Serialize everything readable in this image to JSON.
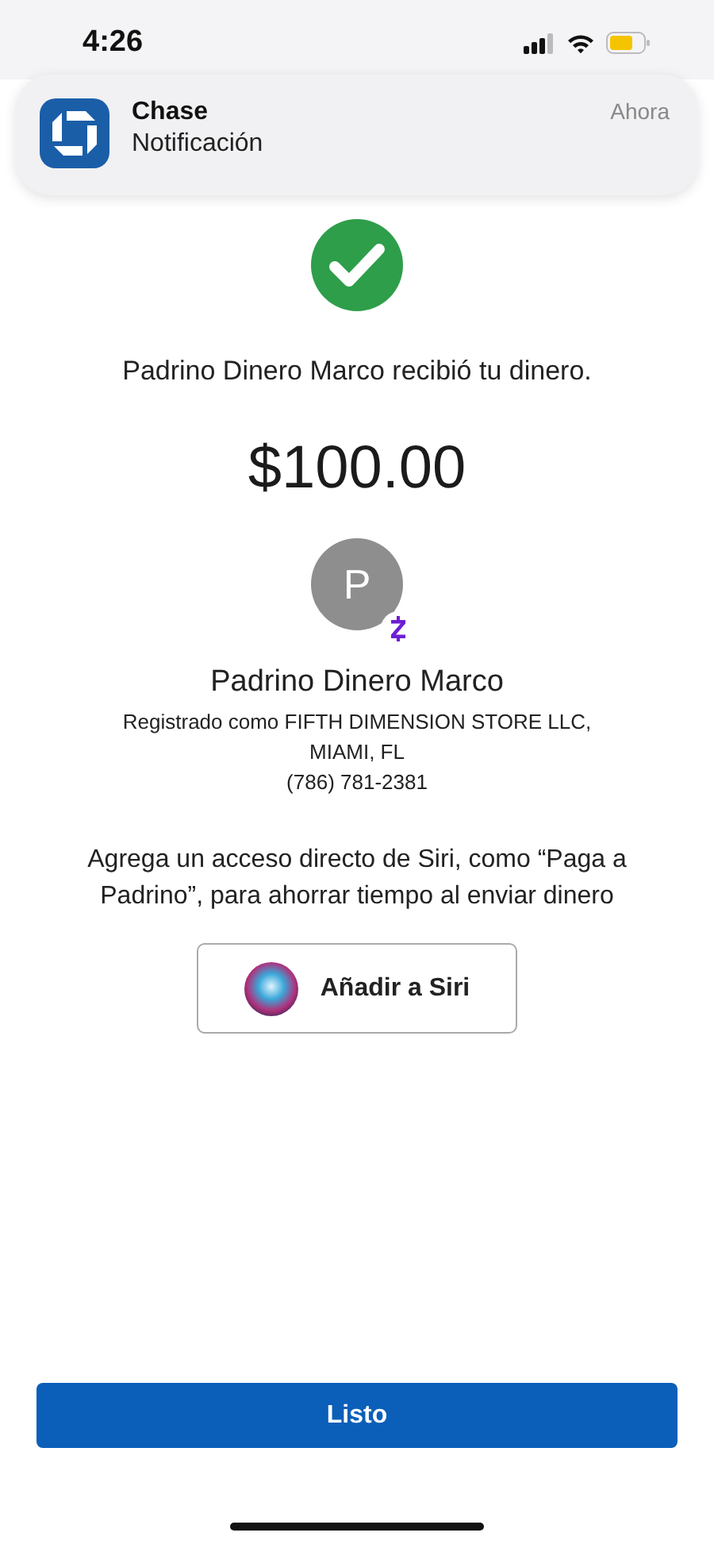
{
  "status_bar": {
    "time": "4:26"
  },
  "notification": {
    "app": "Chase",
    "message": "Notificación",
    "time": "Ahora"
  },
  "confirmation": {
    "message": "Padrino Dinero Marco recibió tu dinero.",
    "amount": "$100.00"
  },
  "recipient": {
    "initial": "P",
    "name": "Padrino Dinero Marco",
    "details": [
      "Registrado como FIFTH DIMENSION STORE LLC,",
      "MIAMI, FL",
      "(786) 781-2381"
    ]
  },
  "siri": {
    "text": "Agrega un acceso directo de Siri, como “Paga a Padrino”, para ahorrar tiempo al enviar dinero",
    "button": "Añadir a Siri"
  },
  "done_button": "Listo"
}
